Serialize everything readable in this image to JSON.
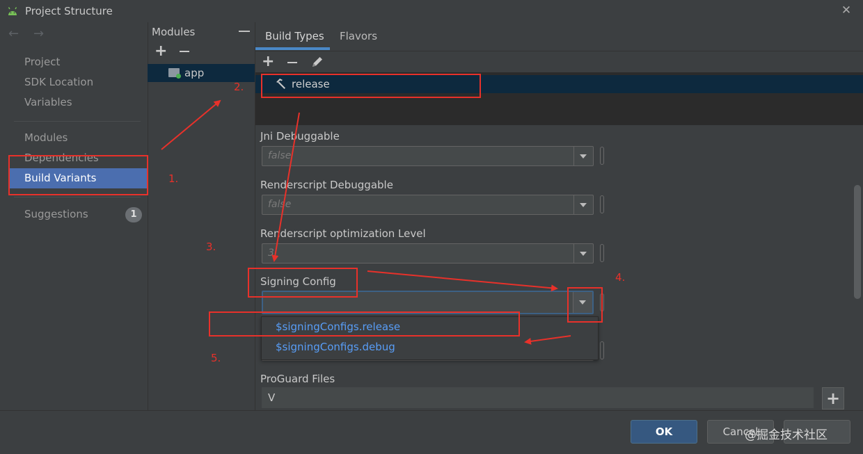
{
  "window": {
    "title": "Project Structure",
    "close_glyph": "✕"
  },
  "nav": {
    "back_glyph": "←",
    "forward_glyph": "→",
    "items": [
      {
        "label": "Project"
      },
      {
        "label": "SDK Location"
      },
      {
        "label": "Variables"
      },
      {
        "label": "Modules"
      },
      {
        "label": "Dependencies"
      },
      {
        "label": "Build Variants"
      },
      {
        "label": "Suggestions"
      }
    ],
    "selected": "Build Variants",
    "suggestions_badge": "1"
  },
  "modules": {
    "title": "Modules",
    "add_glyph": "+",
    "items": [
      {
        "label": "app"
      }
    ]
  },
  "tabs": [
    {
      "label": "Build Types"
    },
    {
      "label": "Flavors"
    }
  ],
  "active_tab": "Build Types",
  "build_types": {
    "add_glyph": "+",
    "items": [
      {
        "label": "release"
      }
    ]
  },
  "fields": {
    "jni_debuggable": {
      "label": "Jni Debuggable",
      "value": "false"
    },
    "renderscript_debuggable": {
      "label": "Renderscript Debuggable",
      "value": "false"
    },
    "renderscript_opt_level": {
      "label": "Renderscript optimization Level",
      "value": "3"
    },
    "signing_config": {
      "label": "Signing Config",
      "value": ""
    },
    "proguard_files": {
      "label": "ProGuard Files",
      "value": "V",
      "add_glyph": "+"
    }
  },
  "signing_dropdown": {
    "options": [
      "$signingConfigs.release",
      "$signingConfigs.debug"
    ]
  },
  "buttons": {
    "ok": "OK",
    "cancel": "Cancel"
  },
  "watermark": "@掘金技术社区",
  "annotations": {
    "step1": "1.",
    "step2": "2.",
    "step3": "3.",
    "step4": "4.",
    "step5": "5."
  },
  "colors": {
    "background": "#3c3f41",
    "selection": "#4b6eaf",
    "link": "#589df6",
    "annotation": "#e8312a",
    "primary_button": "#365880"
  },
  "icons": {
    "app_icon": "android-icon",
    "module_icon": "module-folder-icon",
    "build_type_icon": "hammer-icon",
    "edit_icon": "pencil-icon"
  }
}
